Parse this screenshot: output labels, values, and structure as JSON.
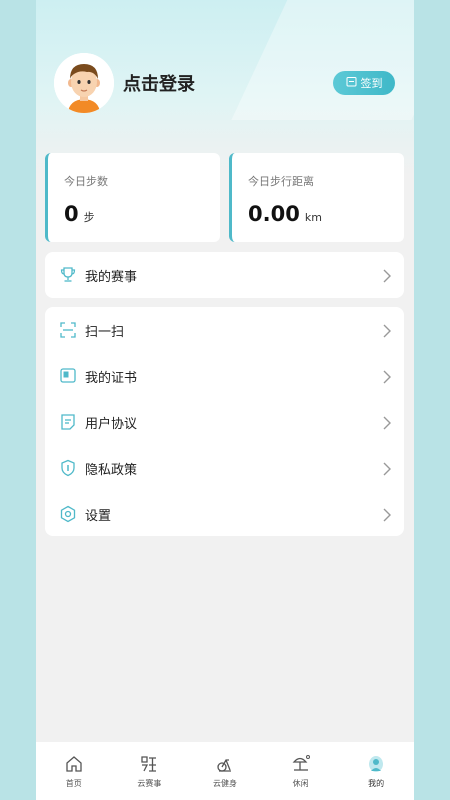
{
  "profile": {
    "login_text": "点击登录",
    "signin_label": "签到"
  },
  "stats": {
    "steps": {
      "label": "今日步数",
      "value": "0",
      "unit": "步"
    },
    "distance": {
      "label": "今日步行距离",
      "value": "0.00",
      "unit": "km"
    }
  },
  "races": {
    "label": "我的赛事",
    "icon": "trophy-icon"
  },
  "menu": {
    "items": [
      {
        "label": "扫一扫",
        "icon": "scan-icon"
      },
      {
        "label": "我的证书",
        "icon": "certificate-icon"
      },
      {
        "label": "用户协议",
        "icon": "agreement-icon"
      },
      {
        "label": "隐私政策",
        "icon": "shield-icon"
      },
      {
        "label": "设置",
        "icon": "gear-icon"
      }
    ]
  },
  "tabbar": {
    "tabs": [
      {
        "label": "首页",
        "icon": "home-icon",
        "active": false
      },
      {
        "label": "云赛事",
        "icon": "race-icon",
        "active": false
      },
      {
        "label": "云健身",
        "icon": "bike-icon",
        "active": false
      },
      {
        "label": "休闲",
        "icon": "leisure-icon",
        "active": false
      },
      {
        "label": "我的",
        "icon": "profile-icon",
        "active": true
      }
    ]
  },
  "colors": {
    "accent": "#4fb9c9",
    "page_bg": "#f1f1f1",
    "outer_bg": "#b9e3e6"
  }
}
